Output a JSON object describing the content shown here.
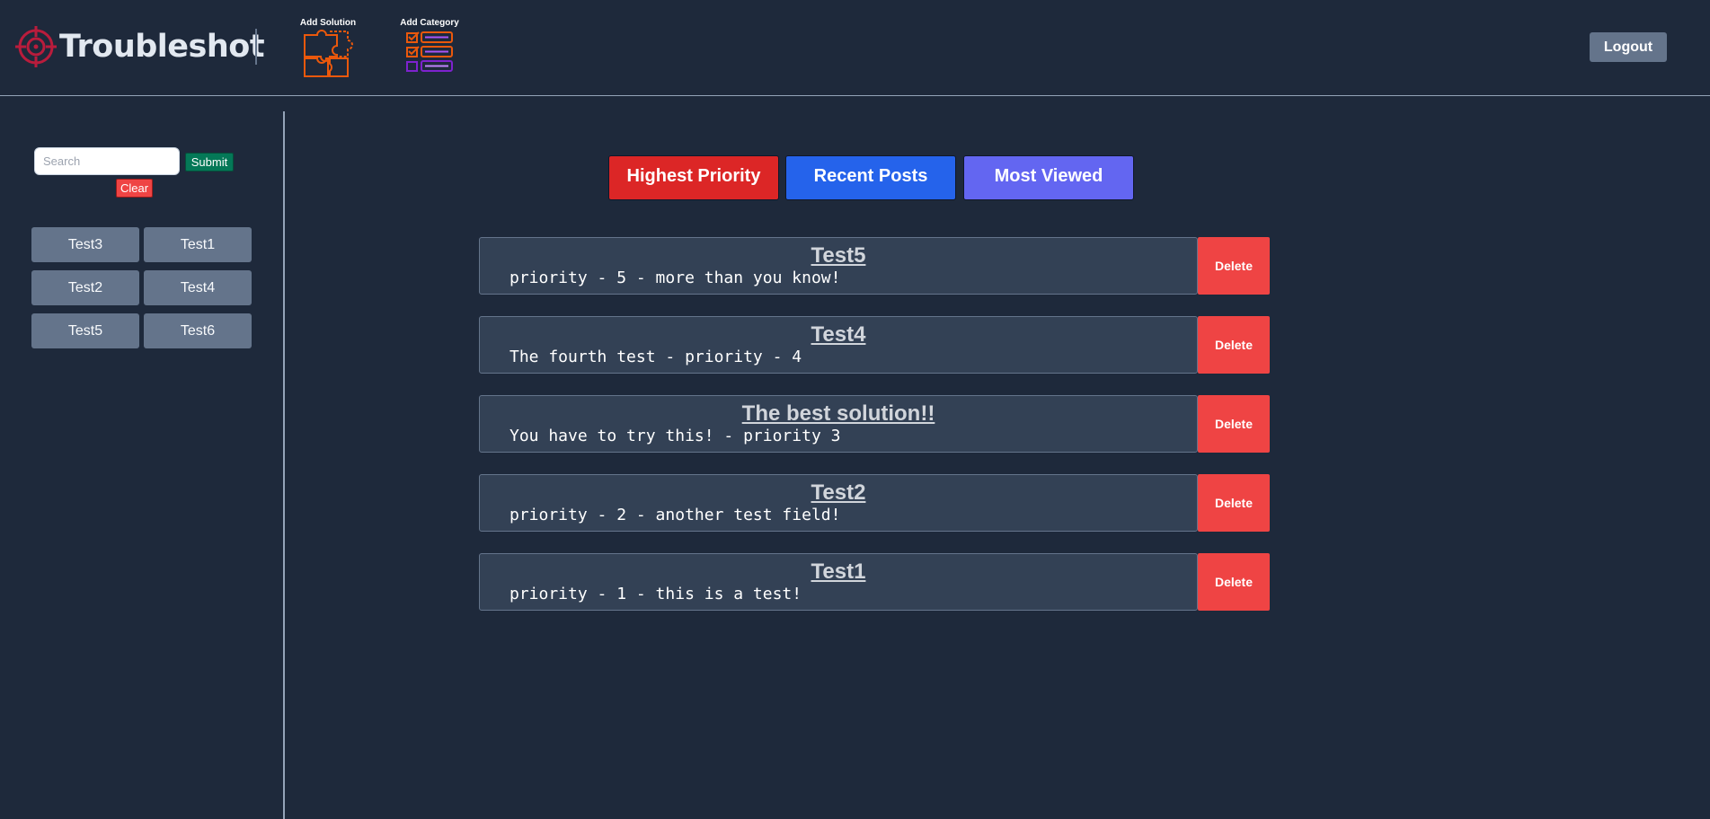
{
  "header": {
    "brand": "Troubleshot",
    "add_solution_label": "Add Solution",
    "add_category_label": "Add Category",
    "logout_label": "Logout"
  },
  "sidebar": {
    "search_placeholder": "Search",
    "search_value": "",
    "submit_label": "Submit",
    "clear_label": "Clear",
    "categories": [
      "Test3",
      "Test1",
      "Test2",
      "Test4",
      "Test5",
      "Test6"
    ]
  },
  "sort_tabs": {
    "highest_priority": "Highest Priority",
    "recent_posts": "Recent Posts",
    "most_viewed": "Most Viewed"
  },
  "posts": [
    {
      "title": "Test5",
      "description": "priority - 5 - more than you know!",
      "delete_label": "Delete"
    },
    {
      "title": "Test4",
      "description": "The fourth test - priority - 4",
      "delete_label": "Delete"
    },
    {
      "title": "The best solution!!",
      "description": "You have to try this! - priority 3",
      "delete_label": "Delete"
    },
    {
      "title": "Test2",
      "description": "priority - 2 - another test field!",
      "delete_label": "Delete"
    },
    {
      "title": "Test1",
      "description": "priority - 1 - this is a test!",
      "delete_label": "Delete"
    }
  ],
  "colors": {
    "background": "#1e293b",
    "card": "#334155",
    "delete": "#ef4444",
    "highest_priority": "#dc2626",
    "recent_posts": "#2563eb",
    "most_viewed": "#6366f1",
    "submit": "#047857",
    "logo_accent": "#b91c3c",
    "icon_orange": "#ea580c"
  },
  "icons": {
    "logo": "crosshair-target-icon",
    "add_solution": "puzzle-pieces-icon",
    "add_category": "checklist-icon"
  }
}
